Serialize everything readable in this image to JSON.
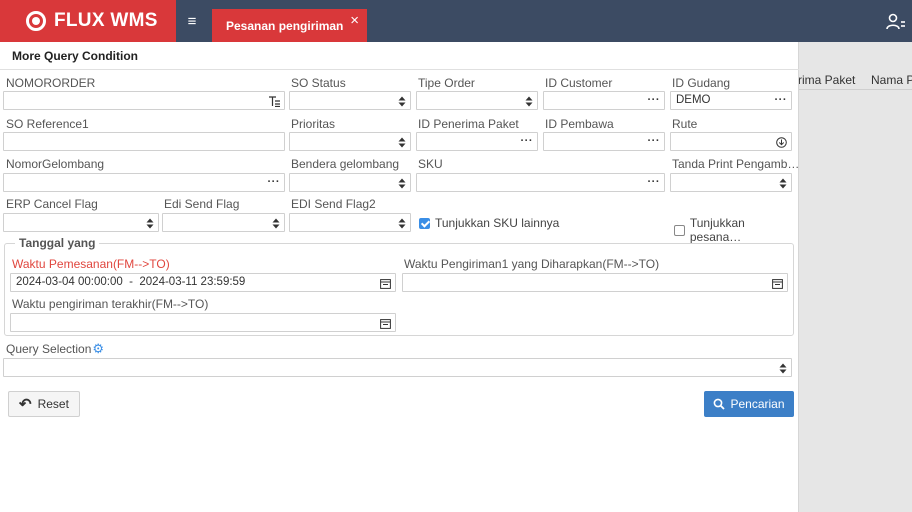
{
  "app": {
    "logo_text": "FLUX WMS"
  },
  "tab": {
    "label": "Pesanan pengiriman",
    "close": "×"
  },
  "menu_toggle": "≡",
  "background_table": {
    "columns": [
      "rima Paket",
      "Nama Pe"
    ]
  },
  "panel": {
    "title": "More Query Condition",
    "row1": {
      "nomororder": {
        "label": "NOMORORDER",
        "value": ""
      },
      "so_status": {
        "label": "SO Status",
        "value": ""
      },
      "tipe_order": {
        "label": "Tipe Order",
        "value": ""
      },
      "id_customer": {
        "label": "ID Customer",
        "value": ""
      },
      "id_gudang": {
        "label": "ID Gudang",
        "value": "DEMO"
      }
    },
    "row2": {
      "so_reference1": {
        "label": "SO Reference1",
        "value": ""
      },
      "prioritas": {
        "label": "Prioritas",
        "value": ""
      },
      "id_penerima_paket": {
        "label": "ID Penerima Paket",
        "value": ""
      },
      "id_pembawa": {
        "label": "ID Pembawa",
        "value": ""
      },
      "rute": {
        "label": "Rute",
        "value": ""
      }
    },
    "row3": {
      "nomor_gelombang": {
        "label": "NomorGelombang",
        "value": ""
      },
      "bendera_gelombang": {
        "label": "Bendera gelombang",
        "value": ""
      },
      "sku": {
        "label": "SKU",
        "value": ""
      },
      "tanda_print": {
        "label": "Tanda Print Pengamb…",
        "value": ""
      }
    },
    "row4": {
      "erp_cancel_flag": {
        "label": "ERP Cancel Flag",
        "value": ""
      },
      "edi_send_flag": {
        "label": "Edi Send Flag",
        "value": ""
      },
      "edi_send_flag2": {
        "label": "EDI Send Flag2",
        "value": ""
      },
      "tunjukkan_sku": {
        "label": "Tunjukkan SKU lainnya",
        "checked": true
      },
      "tunjukkan_pesanan": {
        "label": "Tunjukkan pesana…",
        "checked": false
      }
    },
    "tanggal": {
      "legend": "Tanggal yang",
      "waktu_pemesanan": {
        "label": "Waktu Pemesanan(FM-->TO)",
        "value": "2024-03-04 00:00:00  -  2024-03-11 23:59:59"
      },
      "waktu_pengiriman1": {
        "label": "Waktu Pengiriman1 yang Diharapkan(FM-->TO)",
        "value": ""
      },
      "waktu_pengiriman_terakhir": {
        "label": "Waktu pengiriman terakhir(FM-->TO)",
        "value": ""
      }
    },
    "query_selection": {
      "label": "Query Selection",
      "value": ""
    },
    "buttons": {
      "reset": "Reset",
      "search": "Pencarian"
    }
  },
  "colors": {
    "topbar": "#3c4b63",
    "brand_red": "#d9383a",
    "primary_blue": "#3c7fc7",
    "checkbox_blue": "#3a8ee6"
  }
}
